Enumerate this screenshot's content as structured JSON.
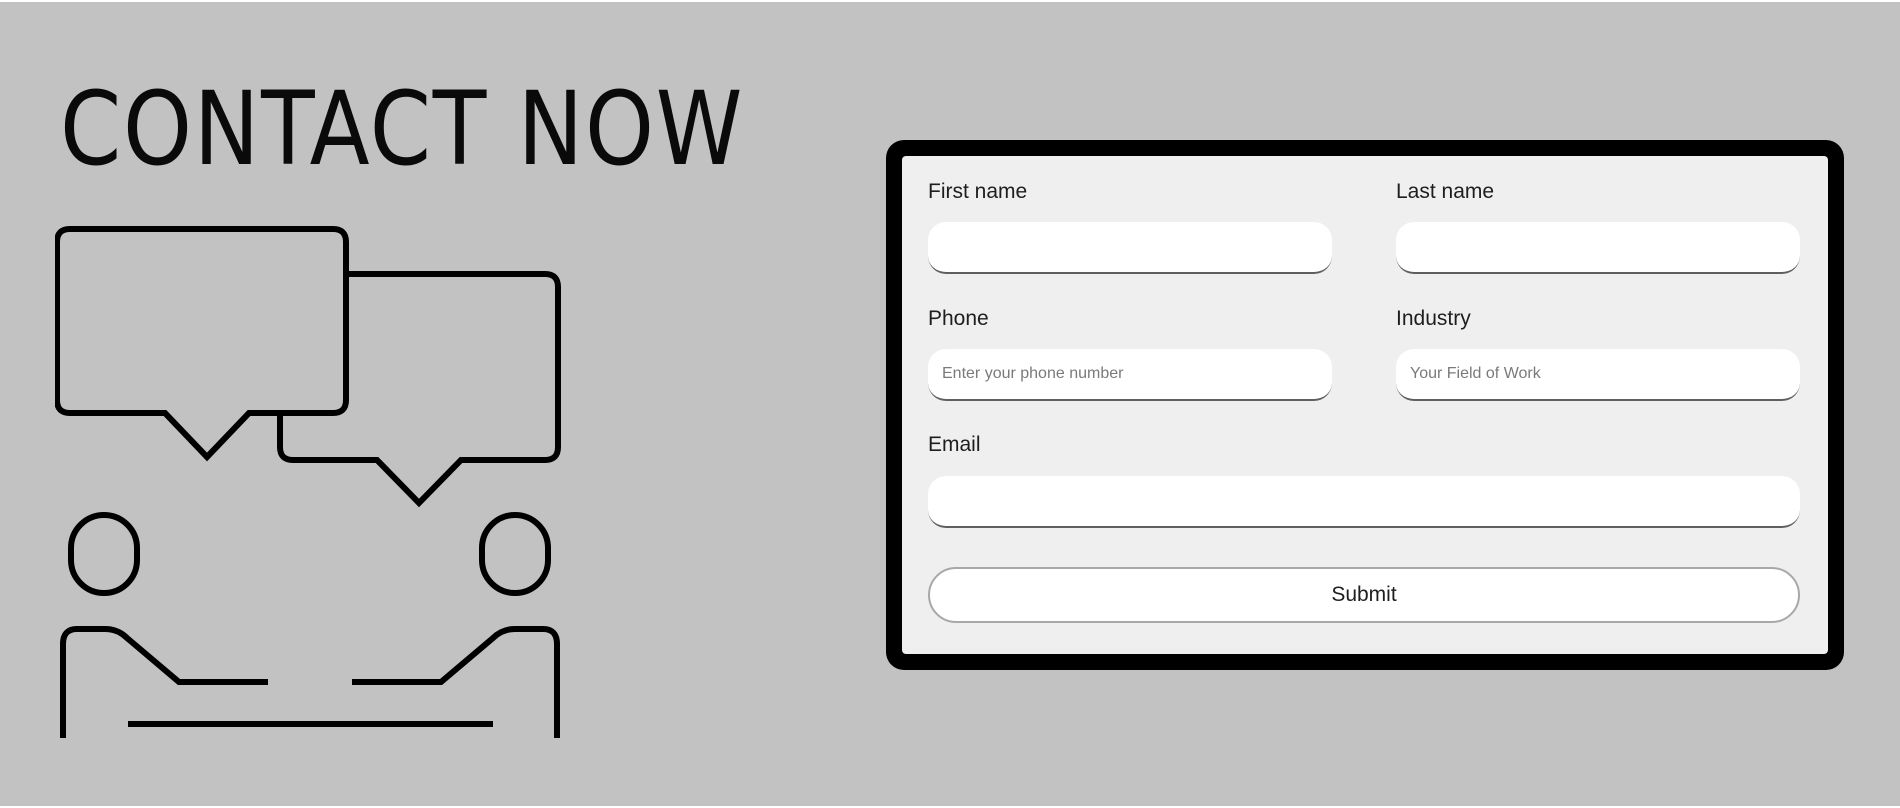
{
  "page": {
    "headline": "CONTACT NOW",
    "background_color": "#c2c2c2"
  },
  "illustration": {
    "icon": "two-people-chat-icon"
  },
  "form": {
    "first_name": {
      "label": "First name",
      "value": "",
      "placeholder": ""
    },
    "last_name": {
      "label": "Last name",
      "value": "",
      "placeholder": ""
    },
    "phone": {
      "label": "Phone",
      "value": "",
      "placeholder": "Enter your phone number"
    },
    "industry": {
      "label": "Industry",
      "value": "",
      "placeholder": "Your Field of Work"
    },
    "email": {
      "label": "Email",
      "value": "",
      "placeholder": ""
    },
    "submit_label": "Submit",
    "frame_color": "#000000",
    "panel_color": "#efefef"
  }
}
